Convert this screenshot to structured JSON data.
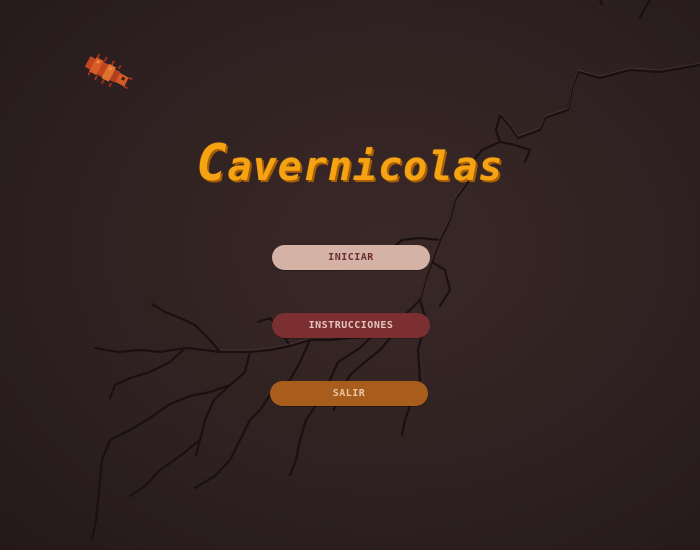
{
  "game": {
    "title": "Cavernicolas",
    "title_first_letter": "C",
    "title_rest": "avernicolas"
  },
  "menu": {
    "start_label": "INICIAR",
    "instructions_label": "INSTRUCCIONES",
    "exit_label": "SALIR"
  },
  "colors": {
    "background": "#2f2020",
    "title": "#f6a313",
    "start_button": "#d4b3a6",
    "instructions_button": "#7c2f31",
    "exit_button": "#a85d1c"
  },
  "icons": {
    "bug": "bug-icon"
  }
}
